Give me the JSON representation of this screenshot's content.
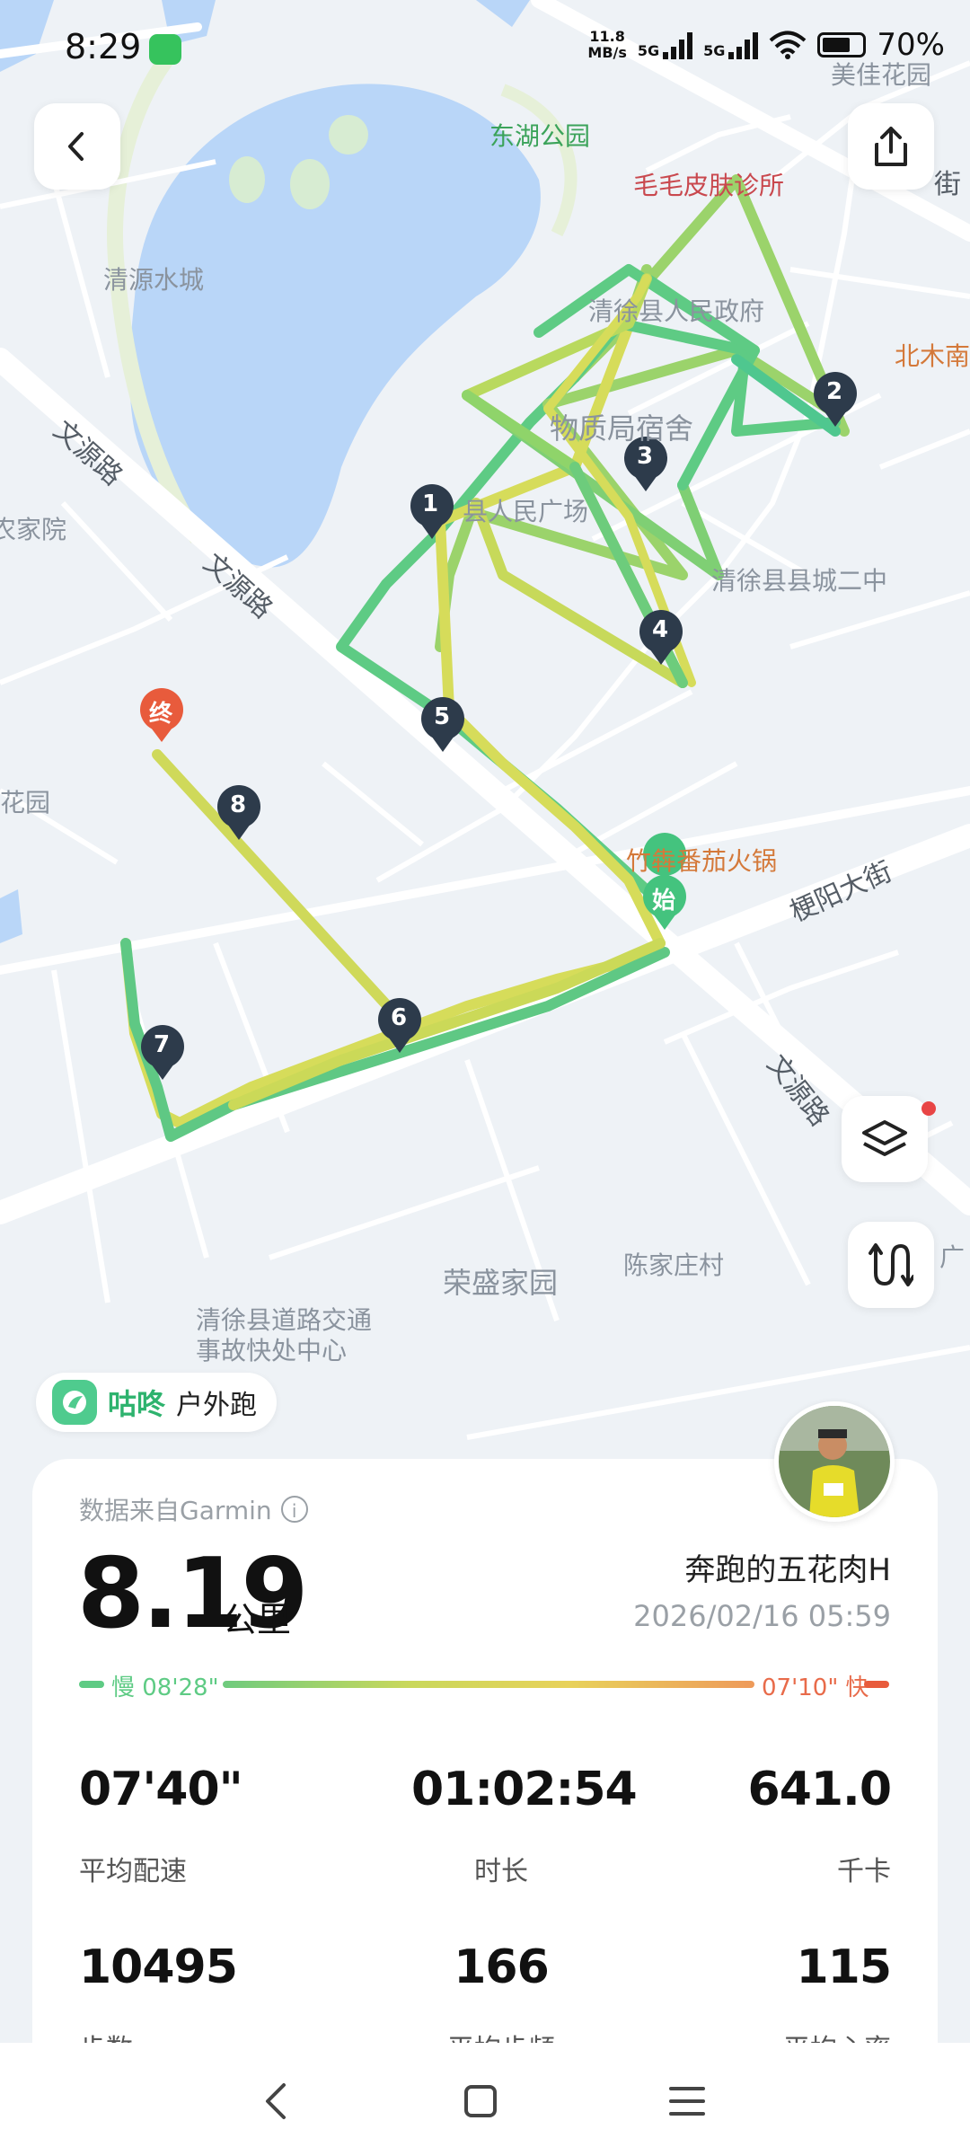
{
  "status_bar": {
    "time": "8:29",
    "net_speed_value": "11.8",
    "net_speed_unit": "MB/s",
    "sim1": "5G",
    "sim2": "5G",
    "battery": "70%"
  },
  "map": {
    "labels": {
      "park": "东湖公园",
      "clinic": "毛毛皮肤诊所",
      "meihua": "美佳花园",
      "beimu": "北木南",
      "qingyuan": "清源水城",
      "gov": "清徐县人民政府",
      "dorm": "物质局宿舍",
      "square": "县人民广场",
      "school": "清徐县县城二中",
      "nongjia": "农家院",
      "huayuan": "花园",
      "hotpot": "竹犇番茄火锅",
      "gengyang": "梗阳大街",
      "rongsheng": "荣盛家园",
      "chenjia": "陈家庄村",
      "traffic_line1": "清徐县道路交通",
      "traffic_line2": "事故快处中心",
      "wenyuan1": "文源路",
      "wenyuan2": "文源路",
      "wenyuan3": "文源路",
      "street_right": "街",
      "guang": "广"
    },
    "markers": {
      "start": "始",
      "end": "终",
      "km": [
        "1",
        "2",
        "3",
        "4",
        "5",
        "6",
        "7",
        "8"
      ]
    }
  },
  "brand": {
    "name": "咕咚",
    "activity_type": "户外跑"
  },
  "summary": {
    "data_source": "数据来自Garmin",
    "distance": "8.19",
    "distance_unit": "公里",
    "username": "奔跑的五花肉H",
    "datetime": "2026/02/16 05:59",
    "slow_label": "慢 08'28\"",
    "fast_label": "07'10\" 快"
  },
  "stats": [
    {
      "value": "07'40\"",
      "label": "平均配速"
    },
    {
      "value": "01:02:54",
      "label": "时长"
    },
    {
      "value": "641.0",
      "label": "千卡"
    },
    {
      "value": "10495",
      "label": "步数"
    },
    {
      "value": "166",
      "label": "平均步频"
    },
    {
      "value": "115",
      "label": "平均心率"
    }
  ],
  "colors": {
    "route_fast": "#3fc486",
    "route_slow": "#d8dc57",
    "water": "#b9d6f8",
    "accent_green": "#2eb36e",
    "end_marker": "#e85b3c"
  },
  "icons": {
    "back": "chevron-left-icon",
    "share": "share-icon",
    "layers": "layers-icon",
    "route": "route-icon"
  }
}
